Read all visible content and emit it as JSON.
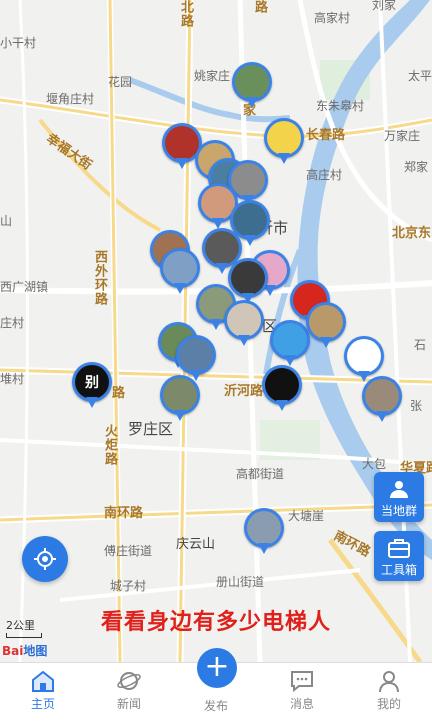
{
  "map": {
    "labels": {
      "beilu": "北路",
      "gaojiacun": "高家村",
      "duiwei": "刘家",
      "xiaoganzi": "小干村",
      "huayuan": "花园",
      "yaojiazhuang": "姚家庄",
      "taiping": "太平",
      "duijiaocun": "堰角庄村",
      "dongshe": "东朱皋村",
      "wanjia": "万家庄",
      "xingfu": "幸福大街",
      "changchun": "长春路",
      "gaozhuang": "高庄村",
      "zhengjia": "郑家",
      "jiashi": "家",
      "yishi": "沂市",
      "beijingdong": "北京东",
      "xiwaihuan": "西外环路",
      "shan": "山",
      "guanghu": "西广湖镇",
      "shi": "石",
      "zhuangcun": "庄村",
      "qu": "区",
      "yihelu": "沂河路",
      "zhang": "张",
      "luozhuang": "罗庄区",
      "dui": "堆村",
      "huoju": "火炬路",
      "dabao": "大包",
      "huaxia": "华夏路",
      "gaodu": "高都街道",
      "datang": "大塘崖",
      "nanhuan_w": "南环路",
      "nanhuan_e": "南环路",
      "fuzhuang": "傅庄街道",
      "qingyunshan": "庆云山",
      "chengzicun": "城子村",
      "cesan": "册山街道",
      "lu": "路",
      "bie": "别"
    },
    "scale_label": "2公里",
    "logo_text": "Bai",
    "logo_text2": "地图",
    "banner": "看看身边有多少电梯人",
    "colors": {
      "accent": "#2c7be5",
      "water": "#a9cbee",
      "banner": "#e0201c"
    }
  },
  "side_buttons": [
    {
      "label": "当地群",
      "icon": "group-icon"
    },
    {
      "label": "工具箱",
      "icon": "toolbox-icon"
    }
  ],
  "locate_icon": "locate-icon",
  "tabs": [
    {
      "label": "主页",
      "icon": "home-icon",
      "active": true
    },
    {
      "label": "新闻",
      "icon": "planet-icon",
      "active": false
    },
    {
      "label": "发布",
      "icon": "plus-icon",
      "active": false
    },
    {
      "label": "消息",
      "icon": "chat-icon",
      "active": false
    },
    {
      "label": "我的",
      "icon": "person-icon",
      "active": false
    }
  ],
  "post_symbol": "+",
  "pins": [
    {
      "name": "user-pin-1",
      "color": "#6b8f5a"
    },
    {
      "name": "user-pin-2",
      "color": "#b0322b"
    },
    {
      "name": "user-pin-3",
      "color": "#c9a66b"
    },
    {
      "name": "user-pin-4",
      "color": "#4a7fa3"
    },
    {
      "name": "user-pin-5",
      "color": "#f2d34a"
    },
    {
      "name": "user-pin-6",
      "color": "#8c8c8c"
    },
    {
      "name": "user-pin-7",
      "color": "#d19a7c"
    },
    {
      "name": "user-pin-8",
      "color": "#3d6e8f"
    },
    {
      "name": "user-pin-9",
      "color": "#a07252"
    },
    {
      "name": "user-pin-10",
      "color": "#7fa0c4"
    },
    {
      "name": "user-pin-11",
      "color": "#5a5a5a"
    },
    {
      "name": "user-pin-12",
      "color": "#e6a8c8"
    },
    {
      "name": "user-pin-13",
      "color": "#d6271f"
    },
    {
      "name": "user-pin-14",
      "color": "#3a3a3a"
    },
    {
      "name": "user-pin-15",
      "color": "#8a9a7a"
    },
    {
      "name": "user-pin-16",
      "color": "#cfc6b8"
    },
    {
      "name": "user-pin-17",
      "color": "#3fa0e6"
    },
    {
      "name": "user-pin-18",
      "color": "#b89a6a"
    },
    {
      "name": "user-pin-19",
      "color": "#6a8a5a"
    },
    {
      "name": "user-pin-20",
      "color": "#ffffff"
    },
    {
      "name": "user-pin-21",
      "color": "#5b7fa6"
    },
    {
      "name": "user-pin-22",
      "color": "#111111"
    },
    {
      "name": "user-pin-23",
      "color": "#7d8a6a"
    },
    {
      "name": "user-pin-24",
      "color": "#9a8a7a"
    },
    {
      "name": "user-pin-25",
      "color": "#8a9cb0"
    }
  ]
}
